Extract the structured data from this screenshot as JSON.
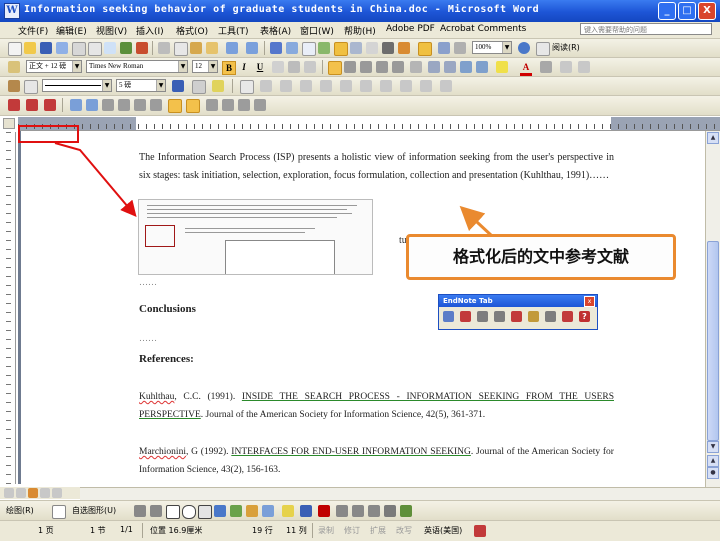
{
  "window": {
    "title": "Information seeking behavior of graduate students in China.doc - Microsoft Word",
    "app_icon": "W",
    "buttons": {
      "minimize": "_",
      "maximize": "□",
      "close": "X"
    }
  },
  "menu": {
    "items": [
      "文件(F)",
      "编辑(E)",
      "视图(V)",
      "插入(I)",
      "格式(O)",
      "工具(T)",
      "表格(A)",
      "窗口(W)",
      "帮助(H)",
      "Adobe PDF",
      "Acrobat Comments"
    ],
    "help_placeholder": "键入需要帮助的问题"
  },
  "toolbar_standard": {
    "zoom": "100%",
    "read_label": "阅读(R)"
  },
  "toolbar_formatting": {
    "style": "正文 + 12 磅",
    "font": "Times New Roman",
    "size": "12",
    "bold": "B",
    "italic": "I",
    "underline": "U",
    "font_color_glyph": "A"
  },
  "toolbar_drawing_top": {
    "line_style": "5 磅"
  },
  "document": {
    "paragraph": "The Information Search Process (ISP) presents a holistic view of information seeking from the user's perspective in six stages: task initiation, selection, exploration, focus formulation, collection and presentation (Kuhlthau, 1991)……",
    "partial_text": "tures",
    "dots1": "……",
    "conclusions": "Conclusions",
    "dots2": "……",
    "references_heading": "References:",
    "ref1": {
      "author": "Kuhlthau",
      "rest_author": ", C.C. (1991). ",
      "title": "INSIDE THE SEARCH PROCESS - INFORMATION SEEKING FROM THE USERS PERSPECTIVE",
      "journal": ". Journal of the American Society for Information Science, 42(5), 361-371."
    },
    "ref2": {
      "author": "Marchionini",
      "rest_author": ", G (1992). ",
      "title": "INTERFACES FOR END-USER INFORMATION SEEKING",
      "journal": ". Journal of the American Society for Information Science, 43(2), 156-163."
    }
  },
  "callout": {
    "text": "格式化后的文中参考文献"
  },
  "endnote_toolbar": {
    "title": "EndNote Tab",
    "close": "x"
  },
  "drawbar": {
    "draw_label": "绘图(R)",
    "autoshape_label": "自选图形(U)"
  },
  "statusbar": {
    "page": "1 页",
    "section": "1 节",
    "page_of": "1/1",
    "position": "位置 16.9厘米",
    "line": "19 行",
    "col": "11 列",
    "rec": "录制",
    "trk": "修订",
    "ext": "扩展",
    "ovr": "改写",
    "lang": "英语(美国)"
  },
  "colors": {
    "titlebar": "#1d55d6",
    "callout_border": "#ea8a2f",
    "annotation_red": "#e01010"
  }
}
